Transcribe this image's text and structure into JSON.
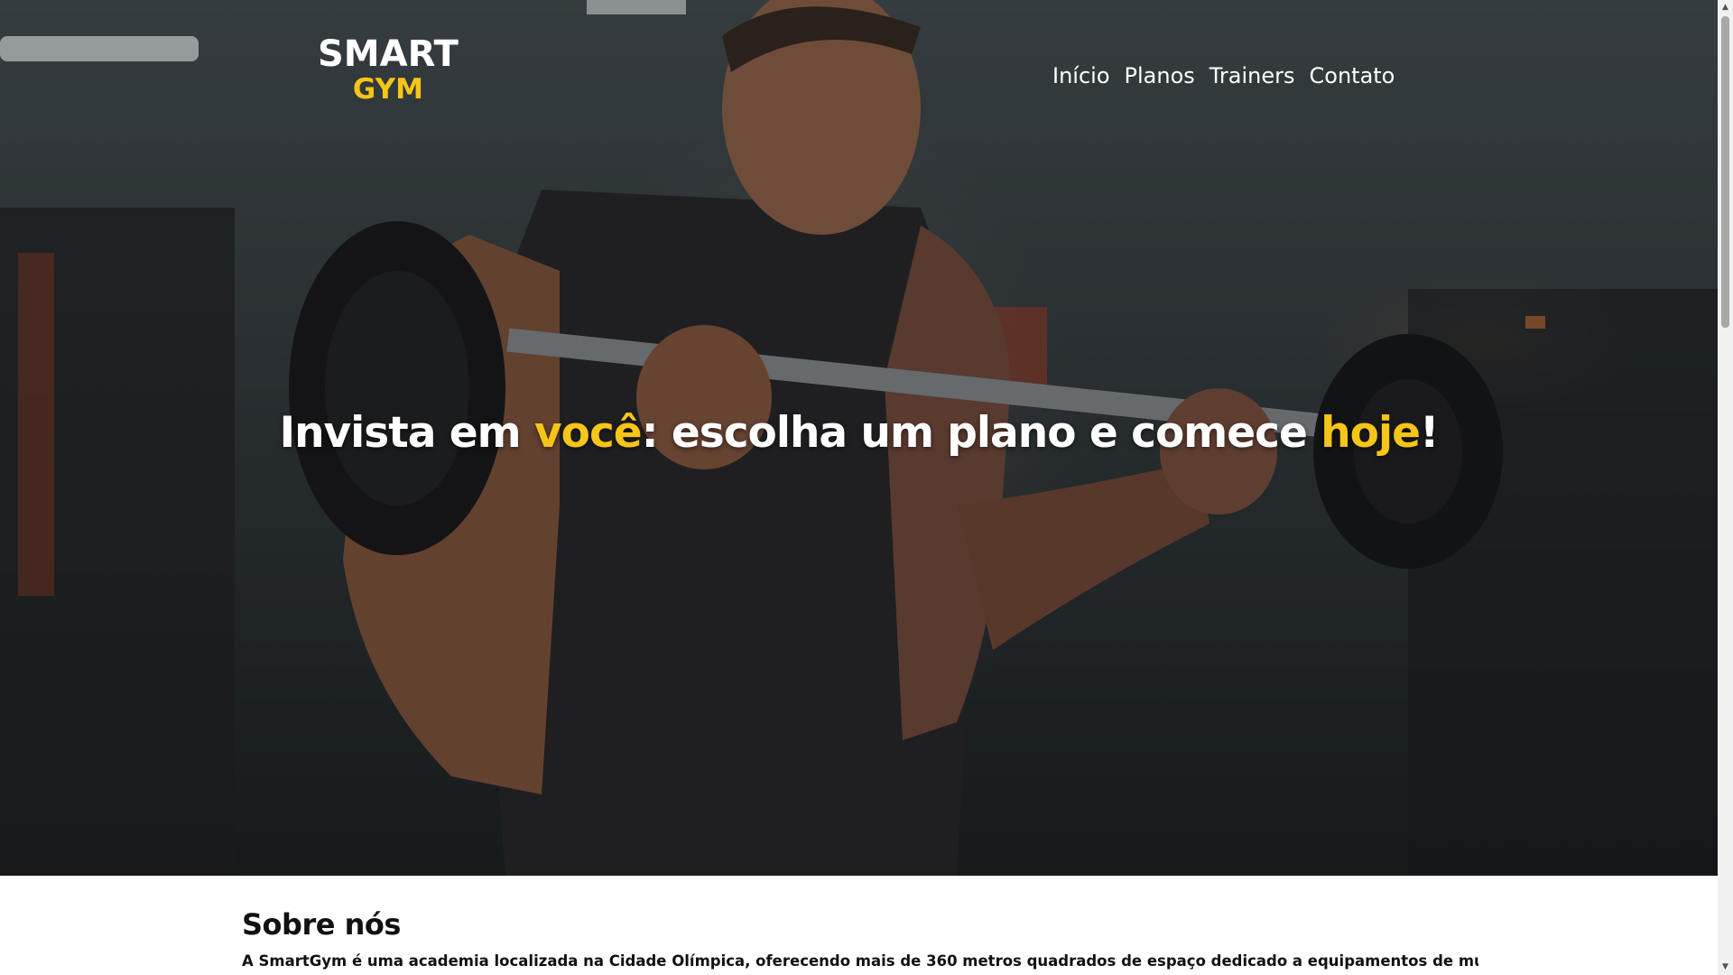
{
  "brand": {
    "line1": "SMART",
    "line2": "GYM",
    "accent_color": "#f5c518"
  },
  "nav": {
    "items": [
      {
        "label": "Início"
      },
      {
        "label": "Planos"
      },
      {
        "label": "Trainers"
      },
      {
        "label": "Contato"
      }
    ]
  },
  "hero": {
    "headline_part1": "Invista em ",
    "headline_highlight1": "você",
    "headline_part2": ": escolha um plano e comece ",
    "headline_highlight2": "hoje",
    "headline_part3": "!"
  },
  "about": {
    "title": "Sobre nós",
    "text": "A SmartGym é uma academia localizada na Cidade Olímpica, oferecendo mais de 360 metros quadrados de espaço dedicado a equipamentos de musculação de"
  },
  "scrollbar": {
    "up_icon": "▲",
    "down_icon": "▼"
  }
}
